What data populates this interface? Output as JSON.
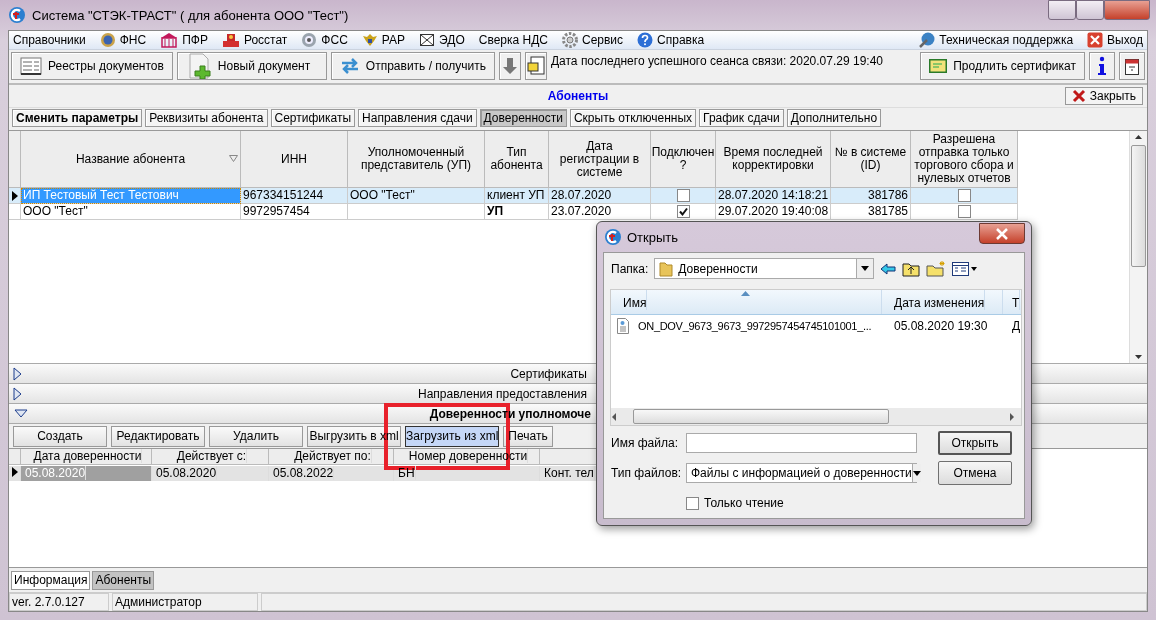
{
  "window": {
    "title": "Система \"СТЭК-ТРАСТ\" ( для абонента ООО \"Тест\")"
  },
  "menu": {
    "items": [
      {
        "label": "Справочники"
      },
      {
        "label": "ФНС"
      },
      {
        "label": "ПФР"
      },
      {
        "label": "Росстат"
      },
      {
        "label": "ФСС"
      },
      {
        "label": "РАР"
      },
      {
        "label": "ЭДО"
      },
      {
        "label": "Сверка НДС"
      },
      {
        "label": "Сервис"
      },
      {
        "label": "Справка"
      }
    ],
    "right": [
      {
        "label": "Техническая поддержка"
      },
      {
        "label": "Выход"
      }
    ]
  },
  "toolbar": {
    "buttons": [
      {
        "label": "Реестры документов"
      },
      {
        "label": "Новый документ"
      },
      {
        "label": "Отправить / получить"
      }
    ],
    "session": "Дата последнего успешного сеанса связи: 2020.07.29 19:40",
    "renew": "Продлить сертификат"
  },
  "section": {
    "title": "Абоненты",
    "close": "Закрыть"
  },
  "tabs": [
    {
      "label": "Сменить параметры",
      "kind": "action",
      "selected": false
    },
    {
      "label": "Реквизиты абонента",
      "kind": "tab",
      "selected": false
    },
    {
      "label": "Сертификаты",
      "kind": "tab",
      "selected": false
    },
    {
      "label": "Направления сдачи",
      "kind": "tab",
      "selected": false
    },
    {
      "label": "Доверенности",
      "kind": "tab",
      "selected": true
    },
    {
      "label": "Скрыть отключенных",
      "kind": "tab",
      "selected": false
    },
    {
      "label": "График сдачи",
      "kind": "tab",
      "selected": false
    },
    {
      "label": "Дополнительно",
      "kind": "tab",
      "selected": false
    }
  ],
  "table": {
    "columns": [
      "Название абонента",
      "ИНН",
      "Уполномоченный представитель (УП)",
      "Тип абонента",
      "Дата регистрации в системе",
      "Подключен ?",
      "Время последней корректировки",
      "№ в системе (ID)",
      "Разрешена отправка только торгового сбора и нулевых отчетов"
    ],
    "rows": [
      {
        "selected": true,
        "name": "ИП Тестовый Тест Тестович",
        "inn": "967334151244",
        "representative": "ООО \"Тест\"",
        "type": "клиент УП",
        "kind": "client",
        "registered": "28.07.2020",
        "connected": false,
        "modified": "28.07.2020 14:18:21",
        "id": "381786",
        "restricted": false
      },
      {
        "selected": false,
        "name": "ООО \"Тест\"",
        "inn": "9972957454",
        "representative": "",
        "type": "УП",
        "kind": "agent",
        "registered": "23.07.2020",
        "connected": true,
        "modified": "29.07.2020 19:40:08",
        "id": "381785",
        "restricted": false
      }
    ]
  },
  "panels": [
    {
      "title": "Сертификаты",
      "expanded": false
    },
    {
      "title": "Направления предоставления",
      "expanded": false
    },
    {
      "title": "Доверенности уполномоче",
      "expanded": true
    }
  ],
  "poa": {
    "buttons": [
      {
        "label": "Создать",
        "selected": false
      },
      {
        "label": "Редактировать",
        "selected": false
      },
      {
        "label": "Удалить",
        "selected": false
      },
      {
        "label": "Выгрузить в xml",
        "selected": false
      },
      {
        "label": "Загрузить из xml",
        "selected": true
      },
      {
        "label": "Печать",
        "selected": false
      }
    ],
    "columns": [
      "Дата доверенности",
      "Действует с:",
      "Действует по:",
      "Номер доверенности"
    ],
    "rows": [
      {
        "selected": true,
        "cells": [
          "05.08.2020",
          "05.08.2020",
          "05.08.2022",
          "БН",
          "Конт. тел"
        ]
      }
    ]
  },
  "bottom_tabs": [
    {
      "label": "Информация",
      "selected": false
    },
    {
      "label": "Абоненты",
      "selected": true
    }
  ],
  "status_bar": [
    "ver. 2.7.0.127",
    "Администратор"
  ],
  "dialog": {
    "title": "Открыть",
    "folder_label": "Папка:",
    "folder": "Доверенности",
    "columns": [
      "Имя",
      "Дата изменения",
      "Т"
    ],
    "files": [
      {
        "name": "ON_DOV_9673_9673_9972957454745101001_...",
        "modified": "05.08.2020 19:30",
        "column_3": "Д",
        "selected": false
      }
    ],
    "filename_label": "Имя файла:",
    "filetype_label": "Тип файлов:",
    "filetype": "Файлы с информацией о доверенности",
    "open": "Открыть",
    "cancel": "Отмена",
    "readonly": {
      "label": "Только чтение",
      "checked": false
    }
  }
}
